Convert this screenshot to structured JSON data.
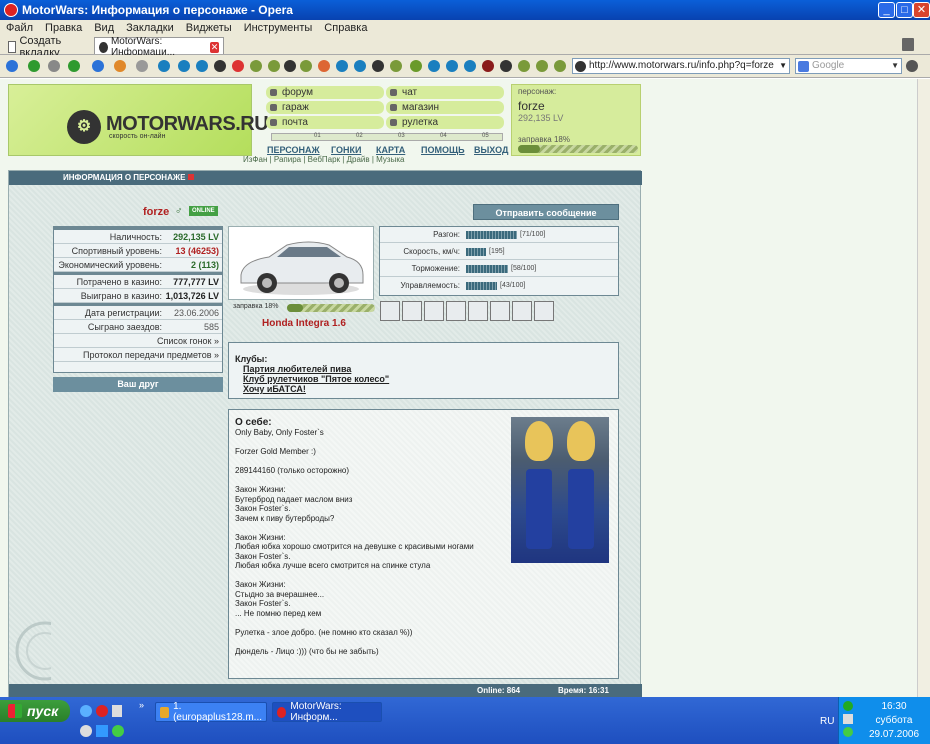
{
  "browser": {
    "window_title": "MotorWars: Информация о персонаже - Opera",
    "menu": [
      "Файл",
      "Правка",
      "Вид",
      "Закладки",
      "Виджеты",
      "Инструменты",
      "Справка"
    ],
    "tabs": [
      {
        "label": "Создать вкладку"
      },
      {
        "label": "MotorWars: Информаци..."
      }
    ],
    "url": "http://www.motorwars.ru/info.php?q=forze",
    "search_placeholder": "Google"
  },
  "site": {
    "logo_name": "MOTORWARS.RU",
    "logo_sub": "скорость он-лайн",
    "nav": [
      "форум",
      "чат",
      "гараж",
      "магазин",
      "почта",
      "рулетка"
    ],
    "ruler_ticks": [
      "01",
      "02",
      "03",
      "04",
      "05"
    ],
    "top_nav": [
      "ПЕРСОНАЖ",
      "ГОНКИ",
      "КАРТА",
      "ПОМОЩЬ",
      "ВЫХОД"
    ],
    "sub_nav": "ИзФан | Рапира | ВебПарк | Драйв | Музыка",
    "player_box": {
      "label": "персонаж:",
      "name": "forze",
      "money": "292,135 LV",
      "fuel_label": "заправка 18%",
      "fuel": 0.18
    }
  },
  "panel": {
    "title": "ИНФОРМАЦИЯ О ПЕРСОНАЖЕ",
    "player_name": "forze",
    "online_badge": "ONLINE",
    "send_message": "Отправить сообщение",
    "stats": [
      {
        "k": "Наличность:",
        "v": "292,135 LV",
        "color": "#2a6a2a"
      },
      {
        "k": "Спортивный уровень:",
        "v": "13 (46253)",
        "color": "#b02020"
      },
      {
        "k": "Экономический уровень:",
        "v": "2 (113)",
        "color": "#2a6a2a"
      },
      {
        "k": "Потрачено в казино:",
        "v": "777,777 LV",
        "color": "#333"
      },
      {
        "k": "Выиграно в казино:",
        "v": "1,013,726 LV",
        "color": "#333"
      },
      {
        "k": "Дата регистрации:",
        "v": "23.06.2006",
        "color": "#555"
      },
      {
        "k": "Сыграно заездов:",
        "v": "585",
        "color": "#555"
      },
      {
        "k": "Список гонок »"
      },
      {
        "k": "Протокол передачи предметов »"
      }
    ],
    "friend_button": "Ваш друг",
    "car": {
      "name": "Honda Integra 1.6",
      "fuel_label": "заправка 18%",
      "fuel": 0.18
    },
    "perf": [
      {
        "k": "Разгон:",
        "val": 71,
        "max": 100,
        "label": "[71/100]"
      },
      {
        "k": "Скорость, км/ч:",
        "val": 195,
        "max": 700,
        "label": "[195]"
      },
      {
        "k": "Торможение:",
        "val": 58,
        "max": 100,
        "label": "[58/100]"
      },
      {
        "k": "Управляемость:",
        "val": 43,
        "max": 100,
        "label": "[43/100]"
      }
    ],
    "clubs_title": "Клубы:",
    "clubs": [
      "Партия любителей пива",
      "Клуб рулетчиков \"Пятое колесо\"",
      "Хочу иБАТСА!"
    ],
    "about_title": "О себе:",
    "about_text": "Only Baby, Only Foster`s\n\nForzer Gold Member :)\n\n289144160 (только осторожно)\n\nЗакон Жизни:\nБутерброд падает маслом вниз\nЗакон Foster`s.\nЗачем к пиву бутерброды?\n\nЗакон Жизни:\nЛюбая юбка хорошо смотрится на девушке с красивыми ногами\nЗакон Foster`s.\nЛюбая юбка лучше всего смотрится на спинке стула\n\nЗакон Жизни:\nСтыдно за вчерашнее...\nЗакон Foster`s.\n... Не помню перед кем\n\nРулетка - злое добро. (не помню кто сказал %))\n\nДюндель - Лицо :))) (что бы не забыть)",
    "online": "Online: 864",
    "time": "Время: 16:31"
  },
  "taskbar": {
    "start": "пуск",
    "items": [
      "1. (europaplus128.m...",
      "MotorWars: Информ..."
    ],
    "lang": "RU",
    "clock": "16:30",
    "day": "суббота",
    "date": "29.07.2006"
  }
}
